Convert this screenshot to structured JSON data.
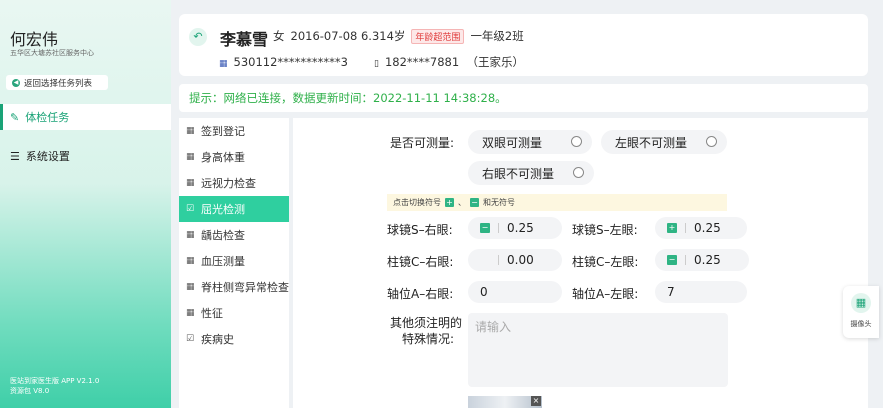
{
  "sidebar": {
    "user_name": "何宏伟",
    "org": "五华区大塘苏社区服务中心",
    "back_label": "返回选择任务列表",
    "nav": [
      {
        "label": "体检任务",
        "icon": "task-icon"
      },
      {
        "label": "系统设置",
        "icon": "settings-icon"
      }
    ],
    "version": "医站到家医生版 APP V2.1.0",
    "resource": "资源包 V8.0"
  },
  "patient": {
    "name": "李慕雪",
    "gender": "女",
    "birth_age": "2016-07-08 6.314岁",
    "age_badge": "年龄超范围",
    "class": "一年级2班",
    "id_number": "530112***********3",
    "phone": "182****7881",
    "guardian": "（王家乐）"
  },
  "tip": "提示：网络已连接，数据更新时间：2022-11-11  14:38:28。",
  "subnav": [
    {
      "label": "签到登记",
      "active": false
    },
    {
      "label": "身高体重",
      "active": false
    },
    {
      "label": "远视力检查",
      "active": false
    },
    {
      "label": "屈光检测",
      "active": true
    },
    {
      "label": "龋齿检查",
      "active": false
    },
    {
      "label": "血压测量",
      "active": false
    },
    {
      "label": "脊柱侧弯异常检查",
      "active": false
    },
    {
      "label": "性征",
      "active": false
    },
    {
      "label": "疾病史",
      "active": false
    }
  ],
  "form": {
    "measurable_label": "是否可测量:",
    "options": [
      "双眼可测量",
      "左眼不可测量",
      "右眼不可测量"
    ],
    "hint_prefix": "点击切换符号",
    "hint_mid": "、",
    "hint_suffix": "和无符号",
    "sphere_right_label": "球镜S–右眼:",
    "sphere_right_sign": "−",
    "sphere_right_value": "0.25",
    "sphere_left_label": "球镜S–左眼:",
    "sphere_left_sign": "+",
    "sphere_left_value": "0.25",
    "cyl_right_label": "柱镜C–右眼:",
    "cyl_right_value": "0.00",
    "cyl_left_label": "柱镜C–左眼:",
    "cyl_left_sign": "−",
    "cyl_left_value": "0.25",
    "axis_right_label": "轴位A–右眼:",
    "axis_right_value": "0",
    "axis_left_label": "轴位A–左眼:",
    "axis_left_value": "7",
    "notes_label_1": "其他须注明的",
    "notes_label_2": "特殊情况:",
    "notes_placeholder": "请输入"
  },
  "camera_label": "摄像头"
}
